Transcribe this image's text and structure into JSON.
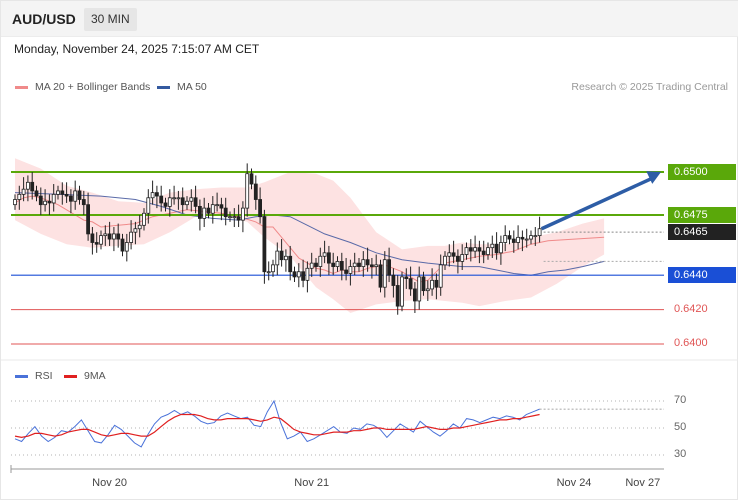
{
  "header": {
    "symbol": "AUD/USD",
    "timeframe": "30 MIN"
  },
  "datetime": "Monday, November 24, 2025 7:15:07 AM CET",
  "legend": {
    "ma20_label": "MA 20 + Bollinger Bands",
    "ma50_label": "MA 50"
  },
  "copyright": "Research © 2025 Trading Central",
  "rsi_legend": {
    "rsi_label": "RSI",
    "ma_label": "9MA"
  },
  "colors": {
    "bollinger_fill": "#fde2e2",
    "ma20": "#f08a8a",
    "ma50": "#5a6aa8",
    "candle": "#222222",
    "resistance": "#5aa80a",
    "pivot": "#1a4fd6",
    "support": "#e05555",
    "last_price": "#222222",
    "arrow": "#2d5da6",
    "rsi": "#4a72d9",
    "rsi_ma": "#e02020"
  },
  "chart_data": {
    "type": "candlestick",
    "price_range": [
      0.6393,
      0.6525
    ],
    "levels": [
      {
        "value": 0.65,
        "label": "0.6500",
        "kind": "resistance"
      },
      {
        "value": 0.6475,
        "label": "0.6475",
        "kind": "resistance"
      },
      {
        "value": 0.6465,
        "label": "0.6465",
        "kind": "last"
      },
      {
        "value": 0.644,
        "label": "0.6440",
        "kind": "pivot"
      },
      {
        "value": 0.642,
        "label": "0.6420",
        "kind": "support"
      },
      {
        "value": 0.64,
        "label": "0.6400",
        "kind": "support"
      }
    ],
    "x_labels": [
      {
        "label": "Nov 20",
        "index": 22
      },
      {
        "label": "Nov 21",
        "index": 69
      },
      {
        "label": "Nov 24",
        "index": 130
      },
      {
        "label": "Nov 27",
        "index": 146
      }
    ],
    "closes": [
      0.6484,
      0.6487,
      0.649,
      0.6494,
      0.6489,
      0.6486,
      0.6481,
      0.6483,
      0.6482,
      0.6487,
      0.6489,
      0.6487,
      0.6486,
      0.6483,
      0.6489,
      0.6484,
      0.6481,
      0.6464,
      0.6459,
      0.6458,
      0.6463,
      0.6464,
      0.6461,
      0.6464,
      0.6461,
      0.6454,
      0.6459,
      0.6465,
      0.6467,
      0.6469,
      0.6476,
      0.6485,
      0.6488,
      0.6486,
      0.6482,
      0.648,
      0.6485,
      0.6485,
      0.6485,
      0.6481,
      0.6483,
      0.6485,
      0.648,
      0.6473,
      0.6479,
      0.6476,
      0.6481,
      0.6481,
      0.6479,
      0.6474,
      0.6474,
      0.6474,
      0.6472,
      0.6479,
      0.6499,
      0.6493,
      0.6484,
      0.6474,
      0.6442,
      0.6442,
      0.6446,
      0.6454,
      0.6449,
      0.6451,
      0.6442,
      0.6439,
      0.6442,
      0.6437,
      0.6444,
      0.6447,
      0.6445,
      0.6451,
      0.6453,
      0.6447,
      0.6445,
      0.6448,
      0.6443,
      0.6441,
      0.6445,
      0.6447,
      0.6445,
      0.6449,
      0.6446,
      0.6445,
      0.6446,
      0.6433,
      0.6449,
      0.644,
      0.6434,
      0.6422,
      0.6439,
      0.6438,
      0.6432,
      0.6425,
      0.6439,
      0.6431,
      0.6432,
      0.6437,
      0.6433,
      0.6446,
      0.6451,
      0.6453,
      0.6451,
      0.6448,
      0.6452,
      0.6456,
      0.6454,
      0.6456,
      0.6454,
      0.6452,
      0.6456,
      0.6458,
      0.6453,
      0.6459,
      0.6463,
      0.6461,
      0.6459,
      0.6462,
      0.6461,
      0.6461,
      0.6463,
      0.6463,
      0.6467
    ],
    "ohlc_note": "Bars plotted left to right at 4.3 px spacing starting at first bar; OHLC derived from closes.",
    "ma20": [
      0.6482,
      0.6485,
      0.6486,
      0.6485,
      0.6483,
      0.6481,
      0.6478,
      0.6475,
      0.6472,
      0.6471,
      0.6468,
      0.6469,
      0.647,
      0.6474,
      0.6476,
      0.6478,
      0.6477,
      0.6476,
      0.6474,
      0.6471,
      0.6468,
      0.6468,
      0.6462,
      0.6456,
      0.645,
      0.6447,
      0.6444,
      0.6443,
      0.6441,
      0.6443,
      0.6442,
      0.6442,
      0.6444,
      0.6445,
      0.6446,
      0.6444,
      0.6442,
      0.6439,
      0.6436,
      0.6437,
      0.6442,
      0.6447,
      0.6449,
      0.6451,
      0.6452,
      0.6454,
      0.6458,
      0.646,
      0.6462
    ],
    "ma20_x": [
      0,
      2,
      4,
      6,
      8,
      10,
      12,
      14,
      16,
      18,
      20,
      24,
      28,
      32,
      36,
      40,
      44,
      48,
      52,
      56,
      58,
      60,
      62,
      64,
      66,
      68,
      70,
      72,
      74,
      76,
      78,
      80,
      82,
      84,
      86,
      88,
      90,
      92,
      94,
      96,
      98,
      100,
      104,
      108,
      112,
      116,
      120,
      124,
      137
    ],
    "ma50": [
      0.6488,
      0.6487,
      0.6486,
      0.6484,
      0.648,
      0.6475,
      0.6473,
      0.6472,
      0.6474,
      0.6475,
      0.6474,
      0.6469,
      0.6464,
      0.6459,
      0.6453,
      0.6449,
      0.6447,
      0.6446,
      0.6445,
      0.6445,
      0.6443,
      0.6441,
      0.644,
      0.6442,
      0.6443,
      0.6445,
      0.6448
    ],
    "ma50_x": [
      0,
      10,
      20,
      28,
      34,
      40,
      46,
      52,
      56,
      60,
      64,
      68,
      72,
      78,
      84,
      90,
      96,
      100,
      104,
      108,
      112,
      116,
      120,
      124,
      128,
      132,
      137
    ],
    "bb_upper": [
      0.6508,
      0.6502,
      0.6492,
      0.6488,
      0.6483,
      0.6482,
      0.6488,
      0.649,
      0.6491,
      0.6491,
      0.6494,
      0.65,
      0.6499,
      0.6495,
      0.6485,
      0.6465,
      0.6455,
      0.6457,
      0.6457,
      0.6459,
      0.6458,
      0.6458,
      0.6462,
      0.6465,
      0.647,
      0.6473
    ],
    "bb_lower": [
      0.6472,
      0.6464,
      0.6458,
      0.6456,
      0.6457,
      0.6458,
      0.6465,
      0.6474,
      0.6475,
      0.6471,
      0.6462,
      0.6451,
      0.6433,
      0.6426,
      0.6418,
      0.6423,
      0.6425,
      0.6426,
      0.6425,
      0.6424,
      0.6422,
      0.6425,
      0.6427,
      0.6435,
      0.6445,
      0.6452
    ],
    "bb_x": [
      0,
      6,
      12,
      18,
      24,
      30,
      36,
      42,
      48,
      54,
      58,
      64,
      70,
      74,
      78,
      84,
      90,
      96,
      100,
      104,
      108,
      114,
      120,
      126,
      132,
      137
    ],
    "forecast_target": 0.65,
    "rsi": {
      "ticks": [
        {
          "value": 70,
          "label": "70"
        },
        {
          "value": 50,
          "label": "50"
        },
        {
          "value": 30,
          "label": "30"
        }
      ],
      "range": [
        25,
        75
      ],
      "rsi": [
        42,
        40,
        46,
        51,
        44,
        40,
        43,
        48,
        47,
        51,
        56,
        48,
        40,
        39,
        45,
        52,
        49,
        44,
        39,
        36,
        45,
        53,
        58,
        60,
        63,
        60,
        62,
        59,
        55,
        53,
        54,
        59,
        61,
        59,
        57,
        58,
        52,
        51,
        62,
        70,
        54,
        42,
        44,
        47,
        40,
        42,
        45,
        48,
        51,
        47,
        46,
        50,
        49,
        53,
        52,
        49,
        43,
        48,
        53,
        50,
        47,
        55,
        51,
        47,
        44,
        48,
        53,
        50,
        57,
        56,
        54,
        56,
        58,
        57,
        59,
        58,
        56,
        60,
        62,
        64
      ],
      "rsi_ma": [
        44,
        43,
        44,
        46,
        46,
        45,
        44,
        45,
        47,
        48,
        49,
        49,
        47,
        45,
        44,
        45,
        46,
        46,
        45,
        44,
        44,
        47,
        51,
        55,
        58,
        60,
        60,
        60,
        59,
        57,
        56,
        56,
        57,
        57,
        57,
        57,
        56,
        55,
        56,
        58,
        57,
        53,
        49,
        47,
        46,
        45,
        45,
        46,
        47,
        47,
        47,
        48,
        48,
        49,
        50,
        50,
        49,
        49,
        49,
        49,
        49,
        50,
        51,
        50,
        49,
        49,
        50,
        50,
        51,
        52,
        53,
        54,
        55,
        56,
        56,
        57,
        57,
        58,
        59,
        60
      ]
    }
  }
}
